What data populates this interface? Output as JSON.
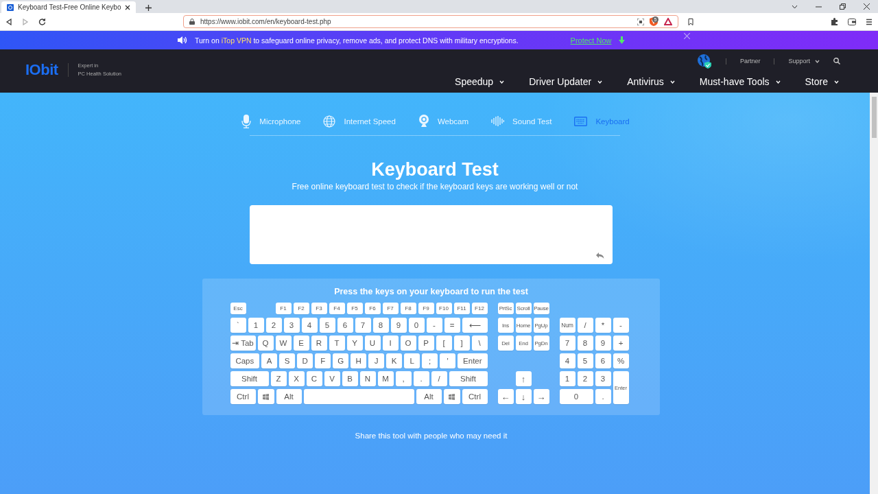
{
  "browser": {
    "tab_title": "Keyboard Test-Free Online Keybo",
    "url": "https://www.iobit.com/en/keyboard-test.php",
    "shield_count": "5"
  },
  "banner": {
    "text_before": "Turn on",
    "link": "iTop VPN",
    "text_after": "to safeguard online privacy, remove ads, and protect DNS with military encryptions.",
    "action": "Protect Now"
  },
  "header": {
    "logo": "IObit",
    "tagline": [
      "Expert in",
      "PC Health Solution"
    ],
    "utility": [
      "Partner",
      "Support"
    ],
    "nav": [
      "Speedup",
      "Driver Updater",
      "Antivirus",
      "Must-have Tools",
      "Store"
    ]
  },
  "tools": [
    {
      "label": "Microphone",
      "kind": "mic",
      "selected": false
    },
    {
      "label": "Internet Speed",
      "kind": "globe",
      "selected": false
    },
    {
      "label": "Webcam",
      "kind": "webcam",
      "selected": false
    },
    {
      "label": "Sound Test",
      "kind": "sound",
      "selected": false
    },
    {
      "label": "Keyboard",
      "kind": "keyboard",
      "selected": true
    }
  ],
  "heading": "Keyboard Test",
  "subheading": "Free online keyboard test to check if the keyboard keys are working well or not",
  "keyboard": {
    "instruction": "Press the keys on your keyboard to run the test",
    "main_rows": [
      [
        {
          "label": "Esc"
        },
        {
          "label": "F1"
        },
        {
          "label": "F2"
        },
        {
          "label": "F3"
        },
        {
          "label": "F4"
        },
        {
          "label": "F5"
        },
        {
          "label": "F6"
        },
        {
          "label": "F7"
        },
        {
          "label": "F8"
        },
        {
          "label": "F9"
        },
        {
          "label": "F10"
        },
        {
          "label": "F11"
        },
        {
          "label": "F12"
        }
      ],
      [
        {
          "label": "`"
        },
        {
          "label": "1"
        },
        {
          "label": "2"
        },
        {
          "label": "3"
        },
        {
          "label": "4"
        },
        {
          "label": "5"
        },
        {
          "label": "6"
        },
        {
          "label": "7"
        },
        {
          "label": "8"
        },
        {
          "label": "9"
        },
        {
          "label": "0"
        },
        {
          "label": "-"
        },
        {
          "label": "="
        },
        {
          "label": "⟵",
          "kind": "wide"
        }
      ],
      [
        {
          "label": "⇥ Tab",
          "kind": "wide"
        },
        {
          "label": "Q"
        },
        {
          "label": "W"
        },
        {
          "label": "E"
        },
        {
          "label": "R"
        },
        {
          "label": "T"
        },
        {
          "label": "Y"
        },
        {
          "label": "U"
        },
        {
          "label": "I"
        },
        {
          "label": "O"
        },
        {
          "label": "P"
        },
        {
          "label": "["
        },
        {
          "label": "]"
        },
        {
          "label": "\\"
        }
      ],
      [
        {
          "label": "Caps",
          "kind": "wide"
        },
        {
          "label": "A"
        },
        {
          "label": "S"
        },
        {
          "label": "D"
        },
        {
          "label": "F"
        },
        {
          "label": "G"
        },
        {
          "label": "H"
        },
        {
          "label": "J"
        },
        {
          "label": "K"
        },
        {
          "label": "L"
        },
        {
          "label": ";"
        },
        {
          "label": "'"
        },
        {
          "label": "Enter",
          "kind": "wide"
        }
      ],
      [
        {
          "label": "Shift",
          "kind": "wide"
        },
        {
          "label": "Z"
        },
        {
          "label": "X"
        },
        {
          "label": "C"
        },
        {
          "label": "V"
        },
        {
          "label": "B"
        },
        {
          "label": "N"
        },
        {
          "label": "M"
        },
        {
          "label": ","
        },
        {
          "label": "."
        },
        {
          "label": "/"
        },
        {
          "label": "Shift",
          "kind": "wide"
        }
      ],
      [
        {
          "label": "Ctrl",
          "kind": "mod"
        },
        {
          "kind": "win"
        },
        {
          "label": "Alt",
          "kind": "mod"
        },
        {
          "kind": "space"
        },
        {
          "label": "Alt",
          "kind": "mod"
        },
        {
          "kind": "win"
        },
        {
          "label": "Ctrl",
          "kind": "mod"
        }
      ]
    ],
    "nav_rows": [
      [
        {
          "label": "PrtSc"
        },
        {
          "label": "Scroll"
        },
        {
          "label": "Pause"
        }
      ],
      [
        {
          "label": "Ins"
        },
        {
          "label": "Home"
        },
        {
          "label": "PgUp"
        }
      ],
      [
        {
          "label": "Del"
        },
        {
          "label": "End"
        },
        {
          "label": "PgDn"
        }
      ],
      [
        {
          "label": "↑",
          "kind": "arrow"
        }
      ],
      [
        {
          "label": "←",
          "kind": "arrow"
        },
        {
          "label": "↓",
          "kind": "arrow"
        },
        {
          "label": "→",
          "kind": "arrow"
        }
      ]
    ],
    "numpad": [
      {
        "label": "Num"
      },
      {
        "label": "/"
      },
      {
        "label": "*"
      },
      {
        "label": "-"
      },
      {
        "label": "7"
      },
      {
        "label": "8"
      },
      {
        "label": "9"
      },
      {
        "label": "+"
      },
      {
        "label": "4"
      },
      {
        "label": "5"
      },
      {
        "label": "6"
      },
      {
        "label": "%"
      },
      {
        "label": "1"
      },
      {
        "label": "2"
      },
      {
        "label": "3"
      },
      {
        "label": "Enter",
        "kind": "tall"
      },
      {
        "label": "0",
        "kind": "double"
      },
      {
        "label": "."
      }
    ]
  },
  "share_text": "Share this tool with people who may need it"
}
